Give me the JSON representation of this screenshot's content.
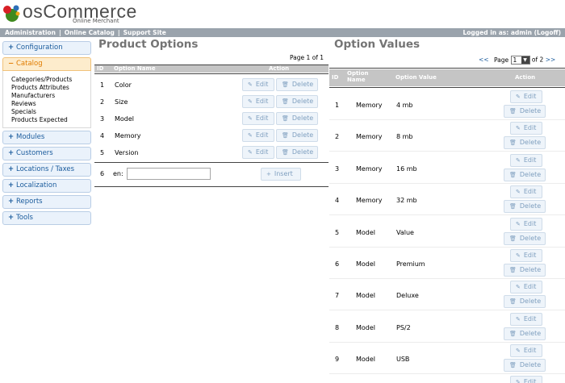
{
  "brand": {
    "name": "osCommerce",
    "tagline": "Online Merchant"
  },
  "topbar": {
    "links": [
      "Administration",
      "Online Catalog",
      "Support Site"
    ],
    "login_text": "Logged in as: admin (Logoff)"
  },
  "sidebar": {
    "configuration": "Configuration",
    "catalog": "Catalog",
    "catalog_items": [
      "Categories/Products",
      "Products Attributes",
      "Manufacturers",
      "Reviews",
      "Specials",
      "Products Expected"
    ],
    "modules": "Modules",
    "customers": "Customers",
    "locations": "Locations / Taxes",
    "localization": "Localization",
    "reports": "Reports",
    "tools": "Tools"
  },
  "options": {
    "title": "Product Options",
    "page_info": "Page 1 of 1",
    "headers": {
      "id": "ID",
      "name": "Option Name",
      "action": "Action"
    },
    "rows": [
      {
        "id": "1",
        "name": "Color"
      },
      {
        "id": "2",
        "name": "Size"
      },
      {
        "id": "3",
        "name": "Model"
      },
      {
        "id": "4",
        "name": "Memory"
      },
      {
        "id": "5",
        "name": "Version"
      }
    ],
    "insert_id": "6",
    "insert_lang": "en:",
    "insert_value": "",
    "insert_label": "Insert"
  },
  "buttons": {
    "edit": "Edit",
    "delete": "Delete"
  },
  "values": {
    "title": "Option Values",
    "pager": {
      "prev": "<<",
      "page_label": "Page",
      "current": "1",
      "of": "of 2",
      "next": ">>"
    },
    "headers": {
      "id": "ID",
      "option_name": "Option Name",
      "option_value": "Option Value",
      "action": "Action"
    },
    "rows": [
      {
        "id": "1",
        "option": "Memory",
        "value": "4 mb"
      },
      {
        "id": "2",
        "option": "Memory",
        "value": "8 mb"
      },
      {
        "id": "3",
        "option": "Memory",
        "value": "16 mb"
      },
      {
        "id": "4",
        "option": "Memory",
        "value": "32 mb"
      },
      {
        "id": "5",
        "option": "Model",
        "value": "Value"
      },
      {
        "id": "6",
        "option": "Model",
        "value": "Premium"
      },
      {
        "id": "7",
        "option": "Model",
        "value": "Deluxe"
      },
      {
        "id": "8",
        "option": "Model",
        "value": "PS/2"
      },
      {
        "id": "9",
        "option": "Model",
        "value": "USB"
      }
    ]
  }
}
